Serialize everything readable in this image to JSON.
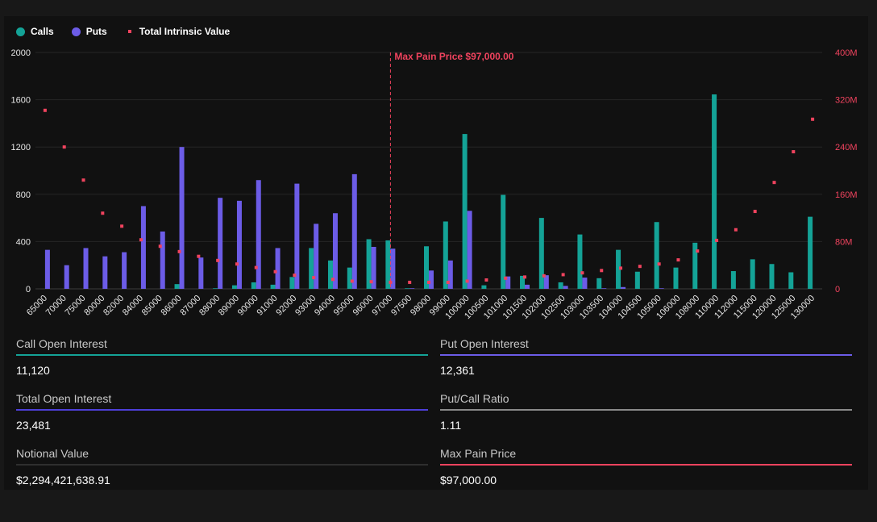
{
  "colors": {
    "calls": "#14a397",
    "puts": "#6c5ce7",
    "intrinsic": "#f0435e",
    "grid": "#262626",
    "axis_text": "#e6e6e6"
  },
  "legend": {
    "calls": "Calls",
    "puts": "Puts",
    "intrinsic": "Total Intrinsic Value"
  },
  "chart_data": {
    "type": "bar",
    "categories": [
      "65000",
      "70000",
      "75000",
      "80000",
      "82000",
      "84000",
      "85000",
      "86000",
      "87000",
      "88000",
      "89000",
      "90000",
      "91000",
      "92000",
      "93000",
      "94000",
      "95000",
      "96000",
      "97000",
      "97500",
      "98000",
      "99000",
      "100000",
      "100500",
      "101000",
      "101500",
      "102000",
      "102500",
      "103000",
      "103500",
      "104000",
      "104500",
      "105000",
      "106000",
      "108000",
      "110000",
      "112000",
      "115000",
      "120000",
      "125000",
      "130000"
    ],
    "series": [
      {
        "name": "Calls",
        "axis": "left",
        "values": [
          0,
          0,
          0,
          0,
          0,
          0,
          0,
          40,
          0,
          5,
          30,
          55,
          35,
          100,
          345,
          240,
          180,
          420,
          410,
          5,
          360,
          570,
          1310,
          30,
          795,
          110,
          600,
          55,
          460,
          90,
          330,
          145,
          565,
          180,
          390,
          1645,
          150,
          250,
          210,
          140,
          610
        ]
      },
      {
        "name": "Puts",
        "axis": "left",
        "values": [
          330,
          200,
          345,
          275,
          310,
          700,
          485,
          1200,
          265,
          770,
          745,
          920,
          345,
          890,
          550,
          640,
          970,
          355,
          340,
          5,
          155,
          240,
          660,
          0,
          105,
          35,
          115,
          25,
          95,
          5,
          15,
          0,
          5,
          0,
          0,
          0,
          0,
          0,
          0,
          0,
          0
        ]
      },
      {
        "name": "Total Intrinsic Value",
        "axis": "right",
        "type": "scatter",
        "values": [
          302,
          240,
          184,
          128,
          106,
          83,
          72,
          63,
          55,
          48,
          42,
          36,
          29,
          23,
          19,
          16,
          13,
          12,
          11,
          11,
          11,
          11,
          13,
          15,
          18,
          20,
          22,
          24,
          27,
          31,
          35,
          38,
          42,
          49,
          64,
          82,
          100,
          131,
          180,
          232,
          287
        ]
      }
    ],
    "y_left": {
      "ticks": [
        "0",
        "400",
        "800",
        "1200",
        "1600",
        "2000"
      ],
      "lim": [
        0,
        2000
      ]
    },
    "y_right": {
      "ticks": [
        "0",
        "80M",
        "160M",
        "240M",
        "320M",
        "400M"
      ],
      "lim": [
        0,
        400
      ],
      "unit": "M"
    },
    "max_pain": {
      "category": "97000",
      "label": "Max Pain Price $97,000.00"
    },
    "grid": true,
    "legend_position": "top-left"
  },
  "stats": [
    {
      "label": "Call Open Interest",
      "value": "11,120",
      "color": "#14a397"
    },
    {
      "label": "Put Open Interest",
      "value": "12,361",
      "color": "#6c5ce7"
    },
    {
      "label": "Total Open Interest",
      "value": "23,481",
      "color": "#4d3fd8"
    },
    {
      "label": "Put/Call Ratio",
      "value": "1.11",
      "color": "#8a8a8a"
    },
    {
      "label": "Notional Value",
      "value": "$2,294,421,638.91",
      "color": "#2e2e2e"
    },
    {
      "label": "Max Pain Price",
      "value": "$97,000.00",
      "color": "#f0435e"
    }
  ]
}
